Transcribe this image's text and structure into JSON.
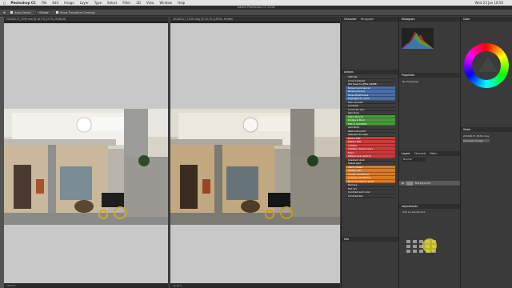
{
  "menubar": {
    "app_name": "Photoshop CC",
    "items": [
      "File",
      "Edit",
      "Image",
      "Layer",
      "Type",
      "Select",
      "Filter",
      "3D",
      "View",
      "Window",
      "Help"
    ],
    "clock": "Wed 23 Jan 18:56"
  },
  "window_title": "Adobe Photoshop CC 2018",
  "options": {
    "auto_select": "Auto-Select:",
    "group": "Group",
    "show_transform": "Show Transform Controls"
  },
  "docs": [
    {
      "tab": "20190217_1335.raw @ 16,7% (Lr77s, RGB/16)",
      "status": "16,67%"
    },
    {
      "tab": "20190217_1530 copy @ 16,7% (LR75s, RGB/8)",
      "status": "16,67%"
    }
  ],
  "panels": {
    "char_tabs": [
      "Character",
      "Paragraph"
    ],
    "actions_label": "Actions",
    "hist_tabs": [
      "Histogram"
    ],
    "props_tabs": [
      "Properties"
    ],
    "props_text": "No Properties",
    "info_label": "Info",
    "layers_tabs": [
      "Layers",
      "Channels",
      "Paths"
    ],
    "layer_mode": "Normal",
    "layer_name": "Background",
    "adjust_label": "Adjustments",
    "adjust_hint": "Add an adjustment",
    "color_tabs": [
      "Color"
    ],
    "hist_panel2": "Histor",
    "hist_items": [
      "20190217_0530.copy",
      "Duplicate Image"
    ]
  },
  "actions": [
    {
      "label": "300 dpi",
      "color": "#3c3c3c"
    },
    {
      "label": "Local contrast",
      "color": "#3c3c3c"
    },
    {
      "label": "JPG Save to JPEG (sRGB)",
      "color": "#3c3c3c"
    },
    {
      "label": "Noise (Luminance)",
      "color": "#4a6ea8"
    },
    {
      "label": "Noise (Colour)",
      "color": "#4a6ea8"
    },
    {
      "label": "Noise Brightness",
      "color": "#4a6ea8"
    },
    {
      "label": "Highlight for print",
      "color": "#4a6ea8"
    },
    {
      "label": "Skin smooth",
      "color": "#3c3c3c"
    },
    {
      "label": "Contrast",
      "color": "#3c3c3c"
    },
    {
      "label": "Correctly skin",
      "color": "#3c3c3c"
    },
    {
      "label": "skin tone",
      "color": "#3c3c3c"
    },
    {
      "label": "Skin retouch",
      "color": "#4a9a3c"
    },
    {
      "label": "Dodge & Burn",
      "color": "#4a9a3c"
    },
    {
      "label": "Flat & add MOO",
      "color": "#4a9a3c"
    },
    {
      "label": "Add MOO",
      "color": "#3c3c3c"
    },
    {
      "label": "Web Copyright",
      "color": "#3c3c3c"
    },
    {
      "label": "Sharpen for web",
      "color": "#3c3c3c"
    },
    {
      "label": "Bump 800",
      "color": "#c83c3c"
    },
    {
      "label": "Resize 800",
      "color": "#c83c3c"
    },
    {
      "label": "1200px",
      "color": "#c83c3c"
    },
    {
      "label": "1500px (watermark)",
      "color": "#c83c3c"
    },
    {
      "label": "Mono",
      "color": "#c83c3c"
    },
    {
      "label": "Watermark (watch)",
      "color": "#c83c3c"
    },
    {
      "label": "Gradient dark",
      "color": "#3c3c3c"
    },
    {
      "label": "Faded split",
      "color": "#3c3c3c"
    },
    {
      "label": "Warm faded",
      "color": "#d87a2a"
    },
    {
      "label": "Sweet color",
      "color": "#d87a2a"
    },
    {
      "label": "Cooler something",
      "color": "#d87a2a"
    },
    {
      "label": "Orange something",
      "color": "#d87a2a"
    },
    {
      "label": "Blue Something 2000",
      "color": "#d87a2a"
    },
    {
      "label": "Red sky",
      "color": "#3c3c3c"
    },
    {
      "label": "Hot sky",
      "color": "#3c3c3c"
    },
    {
      "label": "Contrast and color",
      "color": "#3c3c3c"
    },
    {
      "label": "Contrast big",
      "color": "#3c3c3c"
    }
  ]
}
